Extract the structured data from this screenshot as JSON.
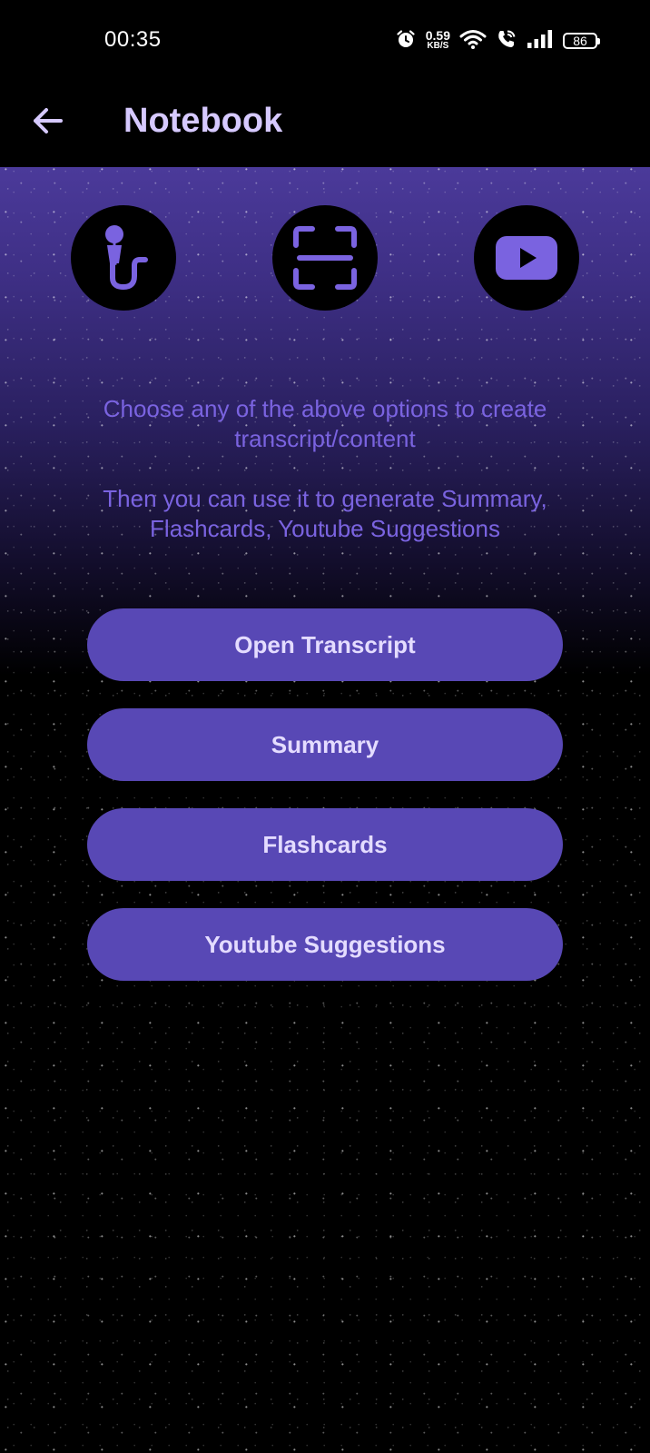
{
  "status_bar": {
    "time": "00:35",
    "net_speed_value": "0.59",
    "net_speed_unit": "KB/S",
    "battery": "86",
    "icons": [
      "alarm-icon",
      "wifi-icon",
      "wifi-call-icon",
      "signal-icon",
      "battery-icon"
    ]
  },
  "app_bar": {
    "title": "Notebook",
    "back_icon": "arrow-left-icon"
  },
  "input_options": [
    {
      "icon": "microphone-icon"
    },
    {
      "icon": "scan-icon"
    },
    {
      "icon": "youtube-icon"
    }
  ],
  "info": {
    "line1": "Choose any of the above options to create transcript/content",
    "line2": "Then you can use it to generate Summary, Flashcards, Youtube Suggestions"
  },
  "actions": {
    "open_transcript": "Open Transcript",
    "summary": "Summary",
    "flashcards": "Flashcards",
    "youtube_suggestions": "Youtube Suggestions"
  },
  "colors": {
    "accent": "#7a63e0",
    "button": "#5848b5",
    "title": "#d6c9ff",
    "background": "#000000"
  }
}
